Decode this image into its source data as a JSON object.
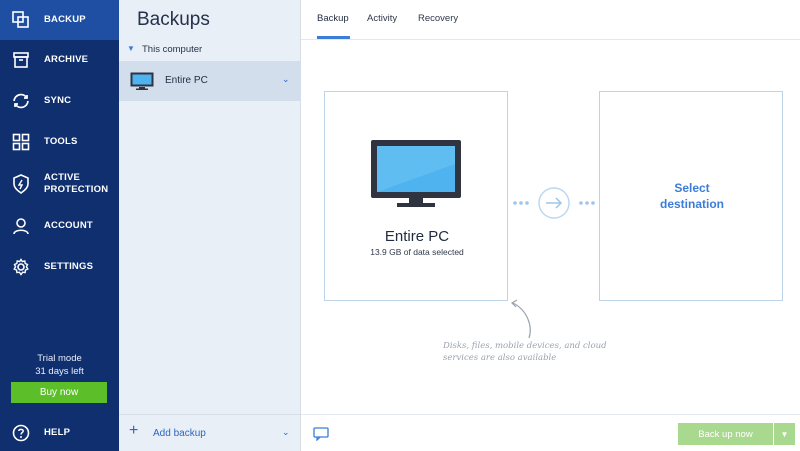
{
  "nav": {
    "items": [
      {
        "label": "BACKUP",
        "icon": "backup-icon"
      },
      {
        "label": "ARCHIVE",
        "icon": "archive-icon"
      },
      {
        "label": "SYNC",
        "icon": "sync-icon"
      },
      {
        "label": "TOOLS",
        "icon": "tools-icon"
      },
      {
        "label_line1": "ACTIVE",
        "label_line2": "PROTECTION",
        "icon": "shield-icon"
      },
      {
        "label": "ACCOUNT",
        "icon": "account-icon"
      },
      {
        "label": "SETTINGS",
        "icon": "gear-icon"
      }
    ],
    "trial_line1": "Trial mode",
    "trial_line2": "31 days left",
    "buy_label": "Buy now",
    "help_label": "HELP"
  },
  "middle": {
    "title": "Backups",
    "group_label": "This computer",
    "item_label": "Entire PC",
    "add_label": "Add backup"
  },
  "main": {
    "tabs": [
      "Backup",
      "Activity",
      "Recovery"
    ],
    "source_title": "Entire PC",
    "source_subtitle": "13.9 GB of data selected",
    "destination_line1": "Select",
    "destination_line2": "destination",
    "hint_line1": "Disks, files, mobile devices, and cloud",
    "hint_line2": "services are also available",
    "backup_button": "Back up now"
  },
  "colors": {
    "nav_bg": "#0f2f6f",
    "nav_active": "#1e4fa3",
    "accent": "#3b7dd8",
    "buy_green": "#5cbf2a",
    "backup_btn_disabled": "#a9d98f"
  }
}
